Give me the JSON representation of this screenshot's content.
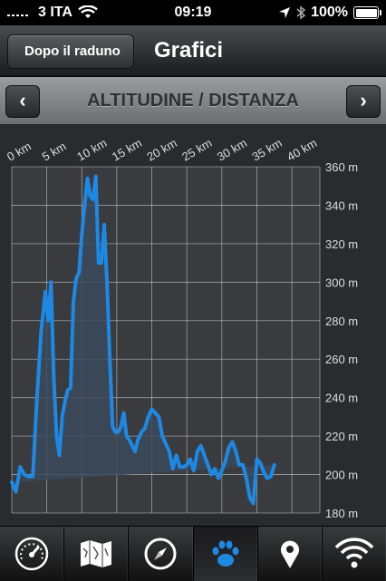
{
  "status": {
    "carrier": "3 ITA",
    "time": "09:19",
    "battery": "100%"
  },
  "nav": {
    "back_label": "Dopo il raduno",
    "title": "Grafici"
  },
  "subnav": {
    "title": "ALTITUDINE / DISTANZA",
    "prev": "‹",
    "next": "›"
  },
  "colors": {
    "line": "#1e88e5",
    "fill": "#3b4a5c",
    "grid": "#c8c8c8"
  },
  "chart_data": {
    "type": "area",
    "xlabel": "",
    "ylabel": "",
    "xlim": [
      0,
      44
    ],
    "ylim": [
      180,
      360
    ],
    "x_ticks": [
      "0 km",
      "5 km",
      "10 km",
      "15 km",
      "20 km",
      "25 km",
      "30 km",
      "35 km",
      "40 km"
    ],
    "y_ticks": [
      "360 m",
      "340 m",
      "320 m",
      "300 m",
      "280 m",
      "260 m",
      "240 m",
      "220 m",
      "200 m",
      "180 m"
    ],
    "x": [
      0,
      0.6,
      1.2,
      1.8,
      2.4,
      3,
      3.6,
      4.2,
      4.8,
      5.2,
      5.6,
      6,
      6.4,
      6.8,
      7.2,
      7.6,
      8,
      8.4,
      8.8,
      9.2,
      9.6,
      10,
      10.4,
      10.8,
      11.2,
      11.6,
      12,
      12.4,
      12.8,
      13.2,
      13.6,
      14,
      14.4,
      14.8,
      15.2,
      15.6,
      16,
      16.4,
      16.8,
      17.2,
      17.6,
      18,
      18.5,
      19,
      19.5,
      20,
      20.5,
      21,
      21.5,
      22,
      22.5,
      23,
      23.5,
      24,
      24.5,
      25,
      25.5,
      26,
      26.5,
      27,
      27.5,
      28,
      28.5,
      29,
      29.5,
      30,
      30.5,
      31,
      31.5,
      32,
      32.5,
      33,
      33.5,
      34,
      34.5,
      35,
      35.5,
      36,
      36.5,
      37,
      37.5,
      38,
      38.5,
      39,
      39.5,
      40,
      40.5,
      41,
      41.5,
      42,
      42.5,
      43
    ],
    "values": [
      196,
      191,
      204,
      200,
      199,
      199,
      240,
      275,
      295,
      280,
      300,
      250,
      220,
      210,
      230,
      238,
      244,
      245,
      290,
      302,
      305,
      325,
      340,
      354,
      345,
      343,
      355,
      310,
      310,
      330,
      300,
      260,
      225,
      222,
      222,
      225,
      232,
      220,
      218,
      215,
      212,
      218,
      222,
      224,
      230,
      234,
      232,
      230,
      220,
      216,
      212,
      203,
      210,
      204,
      204,
      205,
      208,
      202,
      212,
      215,
      210,
      205,
      200,
      203,
      198,
      202,
      207,
      214,
      217,
      212,
      205,
      205,
      198,
      188,
      185,
      208,
      206,
      201,
      198,
      199,
      205
    ]
  },
  "tabs": [
    {
      "name": "speedometer-icon"
    },
    {
      "name": "map-icon"
    },
    {
      "name": "compass-icon"
    },
    {
      "name": "paw-icon"
    },
    {
      "name": "location-pin-icon"
    },
    {
      "name": "wifi-icon"
    }
  ]
}
